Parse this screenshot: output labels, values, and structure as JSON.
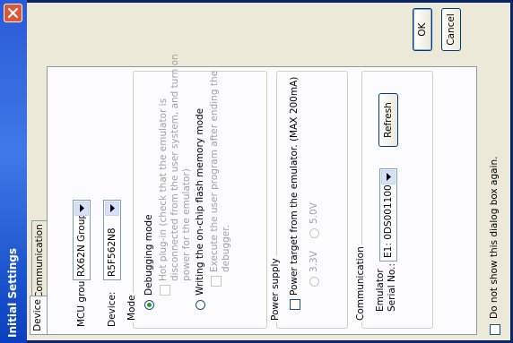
{
  "window": {
    "title": "Initial Settings",
    "close_label": "close"
  },
  "tabs": [
    {
      "label": "Device",
      "active": true
    },
    {
      "label": "Communication",
      "active": false
    }
  ],
  "device": {
    "mcu_group_label": "MCU group:",
    "mcu_group_value": "RX62N Group",
    "device_label": "Device:",
    "device_value": "R5F562N8"
  },
  "mode": {
    "title": "Mode",
    "debugging_label": "Debugging mode",
    "debugging_selected": true,
    "hot_plugin_lines": [
      "Hot plug-in (check that the emulator is",
      "disconnected from the user system, and turn on",
      "power for the emulator)"
    ],
    "writing_label": "Writing the on-chip flash memory mode",
    "writing_selected": false,
    "execute_lines": [
      "Execute the user program after ending the",
      "debugger."
    ]
  },
  "power_supply": {
    "title": "Power supply",
    "power_target_label": "Power target from the emulator. (MAX 200mA)",
    "v33_label": "3.3V",
    "v50_label": "5.0V"
  },
  "communication": {
    "title": "Communication",
    "emulator_serial_lines": [
      "Emulator",
      "Serial No.:"
    ],
    "serial_value": "E1: 0DS001100",
    "refresh_label": "Refresh"
  },
  "buttons": {
    "ok_label": "OK",
    "cancel_label": "Cancel"
  },
  "footer": {
    "do_not_show_label": "Do not show this dialog box again."
  },
  "colors": {
    "title_bar": "#0a3fbf",
    "client": "#ece9d8",
    "radio_selected": "#21a121"
  }
}
